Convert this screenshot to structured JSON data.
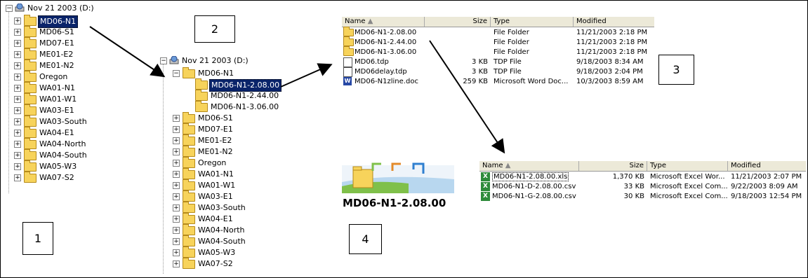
{
  "panel1": {
    "drive": "Nov 21 2003 (D:)",
    "folders": [
      "MD06-N1",
      "MD06-S1",
      "MD07-E1",
      "ME01-E2",
      "ME01-N2",
      "Oregon",
      "WA01-N1",
      "WA01-W1",
      "WA03-E1",
      "WA03-South",
      "WA04-E1",
      "WA04-North",
      "WA04-South",
      "WA05-W3",
      "WA07-S2"
    ],
    "box_label": "1"
  },
  "panel2": {
    "drive": "Nov 21 2003 (D:)",
    "expanded": "MD06-N1",
    "subfolders": [
      "MD06-N1-2.08.00",
      "MD06-N1-2.44.00",
      "MD06-N1-3.06.00"
    ],
    "folders": [
      "MD06-S1",
      "MD07-E1",
      "ME01-E2",
      "ME01-N2",
      "Oregon",
      "WA01-N1",
      "WA01-W1",
      "WA03-E1",
      "WA03-South",
      "WA04-E1",
      "WA04-North",
      "WA04-South",
      "WA05-W3",
      "WA07-S2"
    ],
    "box_label": "2"
  },
  "panel3": {
    "headers": {
      "name": "Name",
      "size": "Size",
      "type": "Type",
      "modified": "Modified"
    },
    "rows": [
      {
        "name": "MD06-N1-2.08.00",
        "size": "",
        "type": "File Folder",
        "modified": "11/21/2003 2:18 PM",
        "icon": "folder"
      },
      {
        "name": "MD06-N1-2.44.00",
        "size": "",
        "type": "File Folder",
        "modified": "11/21/2003 2:18 PM",
        "icon": "folder"
      },
      {
        "name": "MD06-N1-3.06.00",
        "size": "",
        "type": "File Folder",
        "modified": "11/21/2003 2:18 PM",
        "icon": "folder"
      },
      {
        "name": "MD06.tdp",
        "size": "3 KB",
        "type": "TDP File",
        "modified": "9/18/2003 8:34 AM",
        "icon": "file"
      },
      {
        "name": "MD06delay.tdp",
        "size": "3 KB",
        "type": "TDP File",
        "modified": "9/18/2003 2:04 PM",
        "icon": "file"
      },
      {
        "name": "MD06-N1zline.doc",
        "size": "259 KB",
        "type": "Microsoft Word Doc...",
        "modified": "10/3/2003 8:59 AM",
        "icon": "word"
      }
    ],
    "box_label": "3"
  },
  "panel4": {
    "folder_title": "MD06-N1-2.08.00",
    "headers": {
      "name": "Name",
      "size": "Size",
      "type": "Type",
      "modified": "Modified"
    },
    "rows": [
      {
        "name": "MD06-N1-2.08.00.xls",
        "size": "1,370 KB",
        "type": "Microsoft Excel Wor...",
        "modified": "11/21/2003 2:07 PM"
      },
      {
        "name": "MD06-N1-D-2.08.00.csv",
        "size": "33 KB",
        "type": "Microsoft Excel Com...",
        "modified": "9/22/2003 8:09 AM"
      },
      {
        "name": "MD06-N1-G-2.08.00.csv",
        "size": "30 KB",
        "type": "Microsoft Excel Com...",
        "modified": "9/18/2003 12:54 PM"
      }
    ],
    "box_label": "4"
  }
}
